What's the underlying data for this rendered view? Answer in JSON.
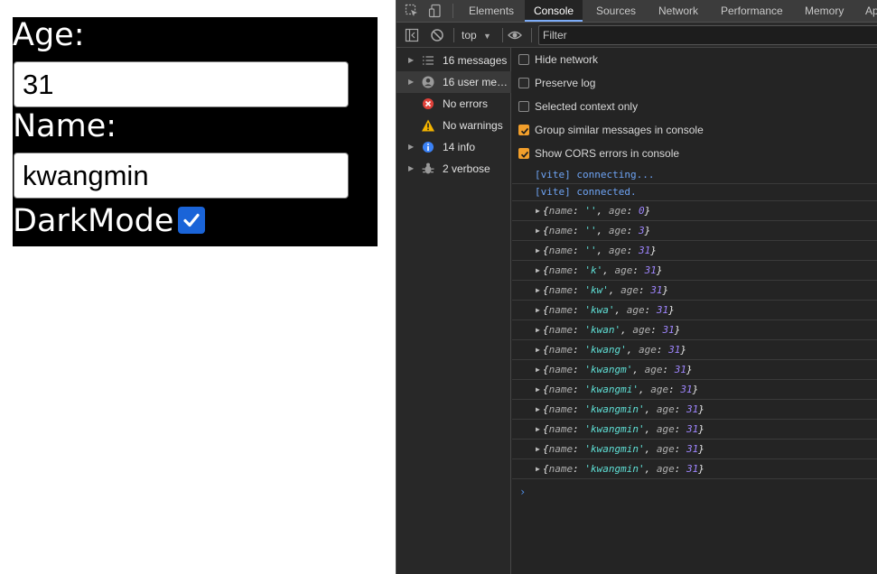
{
  "app": {
    "age_label": "Age:",
    "age_value": "31",
    "name_label": "Name:",
    "name_value": "kwangmin",
    "darkmode_label": "DarkMode",
    "darkmode_checked": true
  },
  "devtools": {
    "tabs": [
      "Elements",
      "Console",
      "Sources",
      "Network",
      "Performance",
      "Memory",
      "Ap"
    ],
    "active_tab": "Console",
    "context": "top",
    "filter_placeholder": "Filter",
    "sidebar": [
      {
        "label": "16 messages",
        "icon": "list-icon",
        "expandable": true
      },
      {
        "label": "16 user me…",
        "icon": "user-icon",
        "expandable": true,
        "selected": true
      },
      {
        "label": "No errors",
        "icon": "error-icon",
        "expandable": false
      },
      {
        "label": "No warnings",
        "icon": "warning-icon",
        "expandable": false
      },
      {
        "label": "14 info",
        "icon": "info-icon",
        "expandable": true
      },
      {
        "label": "2 verbose",
        "icon": "verbose-icon",
        "expandable": true
      }
    ],
    "settings": [
      {
        "label": "Hide network",
        "checked": false
      },
      {
        "label": "Preserve log",
        "checked": false
      },
      {
        "label": "Selected context only",
        "checked": false
      },
      {
        "label": "Group similar messages in console",
        "checked": true
      },
      {
        "label": "Show CORS errors in console",
        "checked": true
      }
    ],
    "vite_logs": [
      "[vite] connecting...",
      "[vite] connected."
    ],
    "object_logs": [
      {
        "name": "''",
        "age": "0"
      },
      {
        "name": "''",
        "age": "3"
      },
      {
        "name": "''",
        "age": "31"
      },
      {
        "name": "'k'",
        "age": "31"
      },
      {
        "name": "'kw'",
        "age": "31"
      },
      {
        "name": "'kwa'",
        "age": "31"
      },
      {
        "name": "'kwan'",
        "age": "31"
      },
      {
        "name": "'kwang'",
        "age": "31"
      },
      {
        "name": "'kwangm'",
        "age": "31"
      },
      {
        "name": "'kwangmi'",
        "age": "31"
      },
      {
        "name": "'kwangmin'",
        "age": "31"
      },
      {
        "name": "'kwangmin'",
        "age": "31"
      },
      {
        "name": "'kwangmin'",
        "age": "31"
      },
      {
        "name": "'kwangmin'",
        "age": "31"
      }
    ],
    "prompt_symbol": "›"
  },
  "colors": {
    "app_background": "#000000",
    "checkbox_accent": "#1a64d8",
    "devtools_background": "#242424",
    "setting_checked": "#f29f2b",
    "vite_text": "#6ea4f5",
    "string_value": "#5fe0d6",
    "number_value": "#9f86ff"
  }
}
